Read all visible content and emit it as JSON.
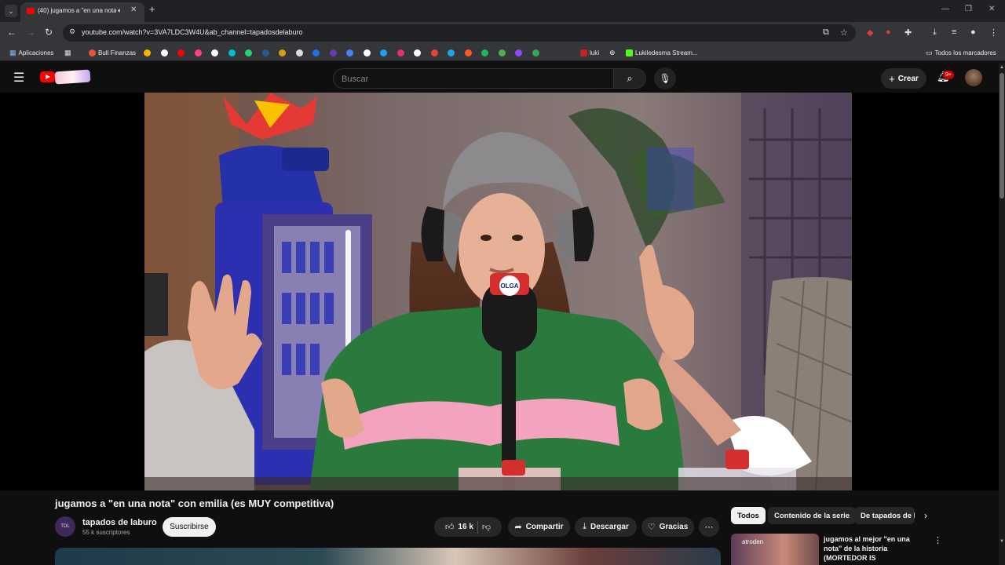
{
  "browser": {
    "tab_title": "(40) jugamos a \"en una nota\" con emilia",
    "url": "youtube.com/watch?v=3VA7LDC3W4U&ab_channel=tapadosdelaburo",
    "bookmarks": [
      {
        "label": "Aplicaciones",
        "icon": "apps-grid-icon",
        "color": "#8ab4f8"
      },
      {
        "label": "Bull Finanzas",
        "icon": "bull-icon",
        "color": "#e8533a"
      },
      {
        "label": "lukì",
        "icon": "bookmark-icon",
        "color": "#c5221f"
      },
      {
        "label": "Lukiledesma Stream...",
        "icon": "kick-icon",
        "color": "#53fc18"
      }
    ],
    "bookmark_icon_colors": [
      "#f4b400",
      "#ffffff",
      "#ff0000",
      "#ff4081",
      "#ffffff",
      "#00bcd4",
      "#25d366",
      "#2b579a",
      "#d4a017",
      "#dddddd",
      "#1a73e8",
      "#673ab7",
      "#4285f4",
      "#ffffff",
      "#1da1f2",
      "#e1306c",
      "#ffffff",
      "#ea4335",
      "#1da1f2",
      "#ff5722",
      "#1db954",
      "#4caf50",
      "#9146ff",
      "#34a853"
    ],
    "all_bookmarks_label": "Todos los marcadores"
  },
  "youtube": {
    "search_placeholder": "Buscar",
    "create_label": "Crear",
    "notifications_badge": "9+",
    "video": {
      "title": "jugamos a \"en una nota\" con emilia (es MUY competitiva)",
      "channel_name": "tapados de laburo",
      "channel_avatar_text": "TDL",
      "subscribers": "55 k suscriptores",
      "subscribe_label": "Suscribirse",
      "likes": "16 k",
      "share_label": "Compartir",
      "download_label": "Descargar",
      "thanks_label": "Gracias",
      "mic_flag_text": "OLGA"
    },
    "chips": [
      "Todos",
      "Contenido de la serie",
      "De tapados de laburo"
    ],
    "recommendation": {
      "thumb_text": "atroden",
      "title": "jugamos al mejor \"en una nota\" de la historia (MORTEDOR IS"
    }
  }
}
